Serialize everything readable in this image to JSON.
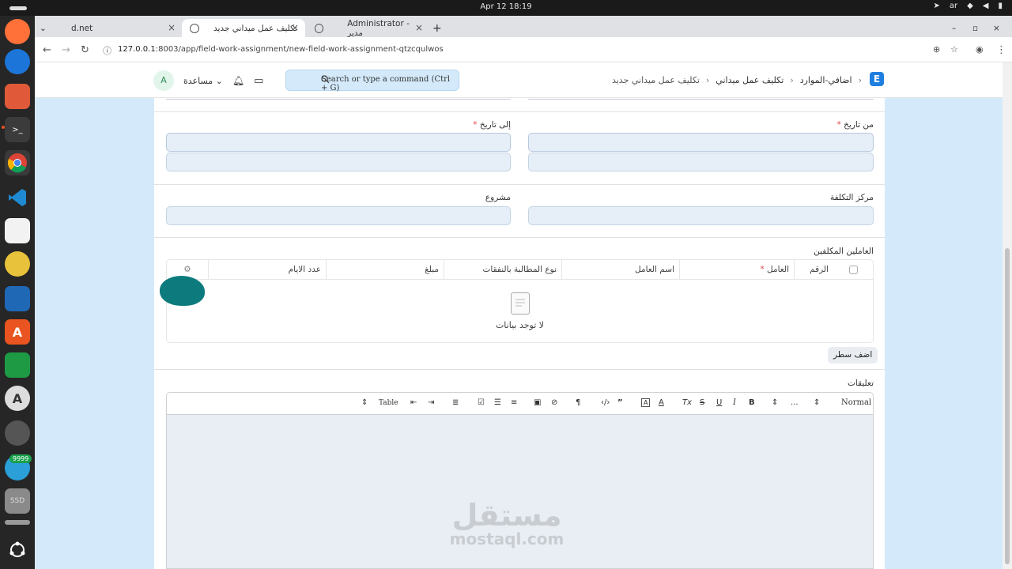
{
  "os": {
    "clock": "Apr 12  18:19",
    "lang": "ar"
  },
  "dock": {
    "badge": "9999",
    "ssd_label": "SSD"
  },
  "browser": {
    "tabs": [
      {
        "title": "d.net"
      },
      {
        "title": "تكليف عمل ميداني جديد"
      },
      {
        "title": "Administrator - مدير"
      }
    ],
    "url_host": "127.0.0.1",
    "url_rest": ":8003/app/field-work-assignment/new-field-work-assignment-qtzcqulwos"
  },
  "navbar": {
    "breadcrumbs": [
      "اضافي-الموارد",
      "تكليف عمل ميداني",
      "تكليف عمل ميداني جديد"
    ],
    "search_placeholder": "Search or type a command (Ctrl + G)",
    "help_label": "مساعدة",
    "avatar_initial": "A"
  },
  "form": {
    "from_date_label": "من تاريخ",
    "to_date_label": "إلى تاريخ",
    "cost_center_label": "مركز التكلفة",
    "project_label": "مشروع",
    "workers_table": {
      "title": "العاملين المكلفين",
      "columns": [
        "الرقم",
        "العامل",
        "اسم العامل",
        "نوع المطالبة بالنفقات",
        "مبلغ",
        "عدد الايام"
      ],
      "empty_text": "لا توجد بيانات",
      "add_row_label": "اضف سطر"
    },
    "comments": {
      "label": "تعليقات",
      "toolbar": {
        "paragraph_style": "Normal",
        "more": "...",
        "table_label": "Table"
      }
    }
  },
  "watermark": {
    "arabic": "مستقل",
    "latin": "mostaql.com"
  }
}
